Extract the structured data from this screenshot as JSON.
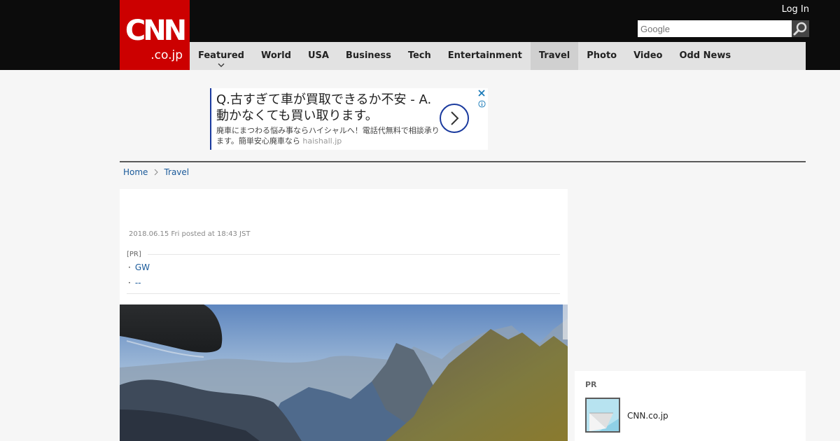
{
  "header": {
    "logo": {
      "main": "CNN",
      "sub": ".co.jp"
    },
    "login_label": "Log In",
    "search": {
      "placeholder": "Google",
      "value": ""
    },
    "nav": [
      {
        "label": "Featured",
        "has_dropdown": true,
        "active": false
      },
      {
        "label": "World",
        "active": false
      },
      {
        "label": "USA",
        "active": false
      },
      {
        "label": "Business",
        "active": false
      },
      {
        "label": "Tech",
        "active": false
      },
      {
        "label": "Entertainment",
        "active": false
      },
      {
        "label": "Travel",
        "active": true
      },
      {
        "label": "Photo",
        "active": false
      },
      {
        "label": "Video",
        "active": false
      },
      {
        "label": "Odd News",
        "active": false
      }
    ]
  },
  "ad": {
    "headline": "Q.古すぎて車が買取できるか不安 - A.動かなくても買い取ります。",
    "description": "廃車にまつわる悩み事ならハイシャルへ！電話代無料で相談承ります。簡単安心廃車なら",
    "domain": "haishall.jp",
    "arrow_icon": "chevron-right-icon",
    "close_icon": "close-icon",
    "info_icon": "info-icon",
    "accent_color": "#1a3a9e"
  },
  "breadcrumb": [
    {
      "label": "Home"
    },
    {
      "label": "Travel"
    }
  ],
  "article": {
    "dateline": "2018.06.15 Fri posted at 18:43 JST",
    "pr": {
      "label": "[PR]",
      "items": [
        {
          "label": "GW"
        },
        {
          "label": "--"
        }
      ]
    }
  },
  "sidebar": {
    "pr_label": "PR",
    "item": {
      "label": "CNN.co.jp",
      "icon": "mail-icon"
    }
  },
  "colors": {
    "brand": "#cc0000",
    "topbar": "#0c0c0c",
    "nav_bg": "#e2e2e2",
    "link": "#1a5a9a"
  }
}
